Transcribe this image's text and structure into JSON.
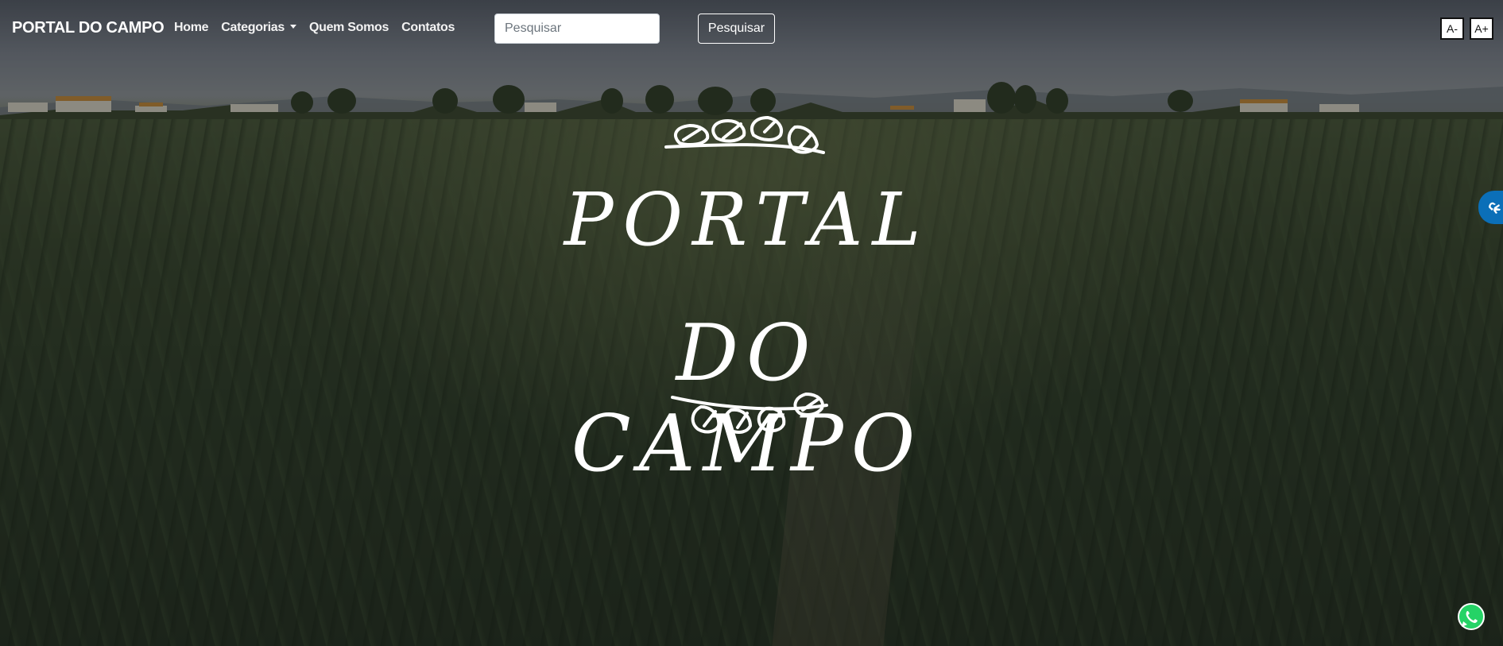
{
  "navbar": {
    "brand": "PORTAL DO CAMPO",
    "links": [
      {
        "label": "Home"
      },
      {
        "label": "Categorias",
        "has_dropdown": true
      },
      {
        "label": "Quem Somos"
      },
      {
        "label": "Contatos"
      }
    ],
    "search": {
      "placeholder": "Pesquisar",
      "value": ""
    },
    "search_button": "Pesquisar",
    "font_decrease": "A-",
    "font_increase": "A+"
  },
  "hero": {
    "logo_line1": "PORTAL",
    "logo_line2": "DO CAMPO"
  },
  "widgets": {
    "vlibras_icon": "sign-language-hands-icon",
    "whatsapp_icon": "whatsapp-icon",
    "vlibras_color": "#0b6fb8",
    "whatsapp_color": "#25d366"
  }
}
